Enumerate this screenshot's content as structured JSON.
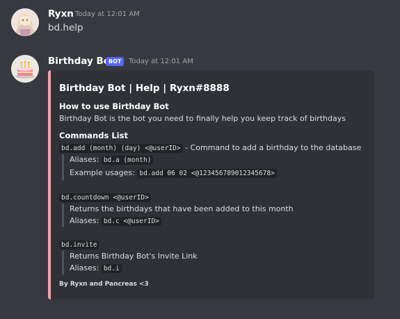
{
  "messages": [
    {
      "author": "Ryxn",
      "timestamp": "Today at 12:01 AM",
      "content": "bd.help"
    },
    {
      "author": "Birthday Bot",
      "bot_tag": "BOT",
      "timestamp": "Today at 12:01 AM",
      "embed": {
        "accent_color": "#f4a1ad",
        "title": "Birthday Bot | Help | Ryxn#8888",
        "how_to_heading": "How to use Birthday Bot",
        "how_to_text": "Birthday Bot is the bot you need to finally help you keep track of birthdays",
        "commands_heading": "Commands List",
        "add": {
          "command": "bd.add (month) (day) <@userID>",
          "description": " - Command to add a birthday to the database",
          "aliases_label": "Aliases: ",
          "aliases_code": "bd.a (month)",
          "example_label": "Example usages: ",
          "example_code": "bd.add 06 02 <@123456789012345678>"
        },
        "countdown": {
          "command": "bd.countdown <@userID>",
          "description": "Returns the birthdays that have been added to this month",
          "aliases_label": "Aliases: ",
          "aliases_code": "bd.c <@userID>"
        },
        "invite": {
          "command": "bd.invite",
          "description": "Returns Birthday Bot's Invite Link",
          "aliases_label": "Aliases: ",
          "aliases_code": "bd.i"
        },
        "footer": "By Ryxn and Pancreas <3"
      }
    }
  ],
  "icons": {
    "ryxn_avatar": "anime-avatar",
    "bot_avatar": "cake-icon"
  },
  "colors": {
    "background": "#36393f",
    "embed_bg": "#2f3136",
    "bot_tag": "#5865f2"
  }
}
